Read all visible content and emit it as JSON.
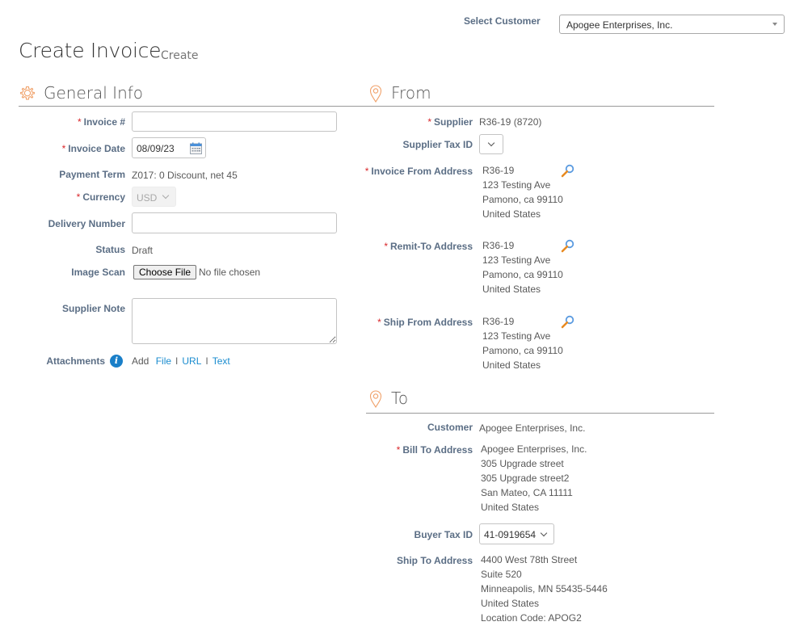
{
  "header": {
    "select_customer_label": "Select Customer",
    "select_customer_value": "Apogee Enterprises, Inc.",
    "title": "Create Invoice",
    "subtitle": "Create"
  },
  "colors": {
    "accent_orange": "#f0a068",
    "label_blue_gray": "#5b6e85",
    "required_red": "#d9262a",
    "link_blue": "#1a8ccf"
  },
  "general_info": {
    "title": "General Info",
    "icon": "gear-icon",
    "invoice_number": {
      "label": "Invoice #",
      "required": true,
      "value": "",
      "placeholder": ""
    },
    "invoice_date": {
      "label": "Invoice Date",
      "required": true,
      "value": "08/09/23",
      "icon": "calendar-icon"
    },
    "payment_term": {
      "label": "Payment Term",
      "value": "Z017: 0 Discount, net 45"
    },
    "currency": {
      "label": "Currency",
      "required": true,
      "value": "USD"
    },
    "delivery_number": {
      "label": "Delivery Number",
      "value": "",
      "placeholder": ""
    },
    "status": {
      "label": "Status",
      "value": "Draft"
    },
    "image_scan": {
      "label": "Image Scan",
      "button": "Choose File",
      "file_text": "No file chosen"
    },
    "supplier_note": {
      "label": "Supplier Note",
      "value": ""
    },
    "attachments": {
      "label": "Attachments",
      "icon": "info-icon",
      "add": "Add",
      "links": [
        "File",
        "URL",
        "Text"
      ],
      "separator": "I"
    }
  },
  "from": {
    "title": "From",
    "icon": "map-pin-icon",
    "supplier": {
      "label": "Supplier",
      "required": true,
      "value": "R36-19 (8720)"
    },
    "supplier_tax_id": {
      "label": "Supplier Tax ID",
      "value": ""
    },
    "invoice_from_address": {
      "label": "Invoice From Address",
      "required": true,
      "lines": [
        "R36-19",
        "123 Testing Ave",
        "Pamono, ca 99110",
        "United States"
      ]
    },
    "remit_to_address": {
      "label": "Remit-To Address",
      "required": true,
      "lines": [
        "R36-19",
        "123 Testing Ave",
        "Pamono, ca 99110",
        "United States"
      ]
    },
    "ship_from_address": {
      "label": "Ship From Address",
      "required": true,
      "lines": [
        "R36-19",
        "123 Testing Ave",
        "Pamono, ca 99110",
        "United States"
      ]
    }
  },
  "to": {
    "title": "To",
    "icon": "map-pin-icon",
    "customer": {
      "label": "Customer",
      "value": "Apogee Enterprises, Inc."
    },
    "bill_to_address": {
      "label": "Bill To Address",
      "required": true,
      "lines": [
        "Apogee Enterprises, Inc.",
        "305 Upgrade street",
        "305 Upgrade street2",
        "San Mateo, CA 11111",
        "United States"
      ]
    },
    "buyer_tax_id": {
      "label": "Buyer Tax ID",
      "value": "41-0919654"
    },
    "ship_to_address": {
      "label": "Ship To Address",
      "lines": [
        "4400 West 78th Street",
        "Suite 520",
        "Minneapolis, MN 55435-5446",
        "United States",
        "Location Code: APOG2"
      ]
    }
  },
  "required_marker": "*"
}
